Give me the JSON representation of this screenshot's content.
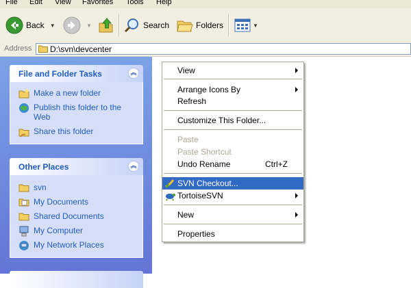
{
  "menubar": {
    "items": [
      "File",
      "Edit",
      "View",
      "Favorites",
      "Tools",
      "Help"
    ]
  },
  "toolbar": {
    "back": "Back",
    "search": "Search",
    "folders": "Folders"
  },
  "address": {
    "label": "Address",
    "path": "D:\\svn\\devcenter"
  },
  "tasks": {
    "title": "File and Folder Tasks",
    "items": [
      "Make a new folder",
      "Publish this folder to the Web",
      "Share this folder"
    ]
  },
  "places": {
    "title": "Other Places",
    "items": [
      "svn",
      "My Documents",
      "Shared Documents",
      "My Computer",
      "My Network Places"
    ]
  },
  "context_menu": {
    "items": [
      {
        "label": "View",
        "submenu": true
      },
      {
        "label": "Arrange Icons By",
        "submenu": true
      },
      {
        "label": "Refresh"
      },
      {
        "label": "Customize This Folder..."
      },
      {
        "label": "Paste",
        "disabled": true
      },
      {
        "label": "Paste Shortcut",
        "disabled": true
      },
      {
        "label": "Undo Rename",
        "shortcut": "Ctrl+Z"
      },
      {
        "label": "SVN Checkout...",
        "highlighted": true
      },
      {
        "label": "TortoiseSVN",
        "submenu": true
      },
      {
        "label": "New",
        "submenu": true
      },
      {
        "label": "Properties"
      }
    ]
  },
  "colors": {
    "highlight": "#316ac5",
    "link": "#215dc6",
    "panel": "#6f8ee0",
    "disabled": "#aca899"
  }
}
